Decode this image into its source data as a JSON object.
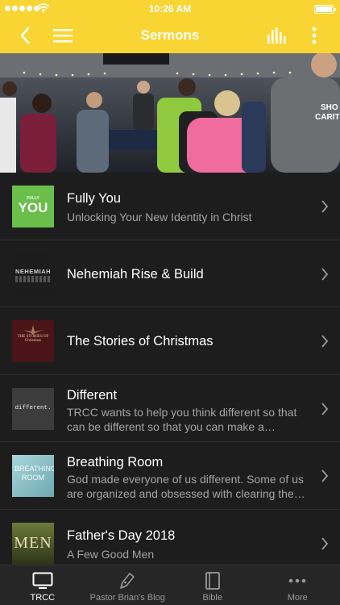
{
  "status_bar": {
    "time": "10:26 AM"
  },
  "nav": {
    "title": "Sermons"
  },
  "sermons": [
    {
      "title": "Fully You",
      "subtitle": "Unlocking Your New Identity in Christ",
      "thumb_text_small": "FULLY",
      "thumb_text": "YOU",
      "thumb_color": "#6abf4b"
    },
    {
      "title": "Nehemiah Rise & Build",
      "subtitle": "",
      "thumb_text": "NEHEMIAH",
      "thumb_color": "#2a2a2a"
    },
    {
      "title": "The Stories of Christmas",
      "subtitle": "",
      "thumb_text": "THE STORIES OF Christmas",
      "thumb_color": "#4a1418"
    },
    {
      "title": "Different",
      "subtitle": "TRCC wants to help you think different so that  can be different so that you can make a difference.",
      "thumb_text": "different.",
      "thumb_color": "#3c3c3c"
    },
    {
      "title": "Breathing Room",
      "subtitle": "God made everyone of us different.  Some of us are organized and obsessed with clearing the clutter.",
      "thumb_text": "BREATHING ROOM",
      "thumb_color": "#8fc3c9"
    },
    {
      "title": "Father's Day 2018",
      "subtitle": "A Few Good Men",
      "thumb_text": "MEN",
      "thumb_color": "#4a5a2a"
    }
  ],
  "tabs": [
    {
      "label": "TRCC",
      "icon": "tv-icon",
      "active": true
    },
    {
      "label": "Pastor Brian's Blog",
      "icon": "pen-icon",
      "active": false
    },
    {
      "label": "Bible",
      "icon": "book-icon",
      "active": false
    },
    {
      "label": "More",
      "icon": "more-icon",
      "active": false
    }
  ]
}
